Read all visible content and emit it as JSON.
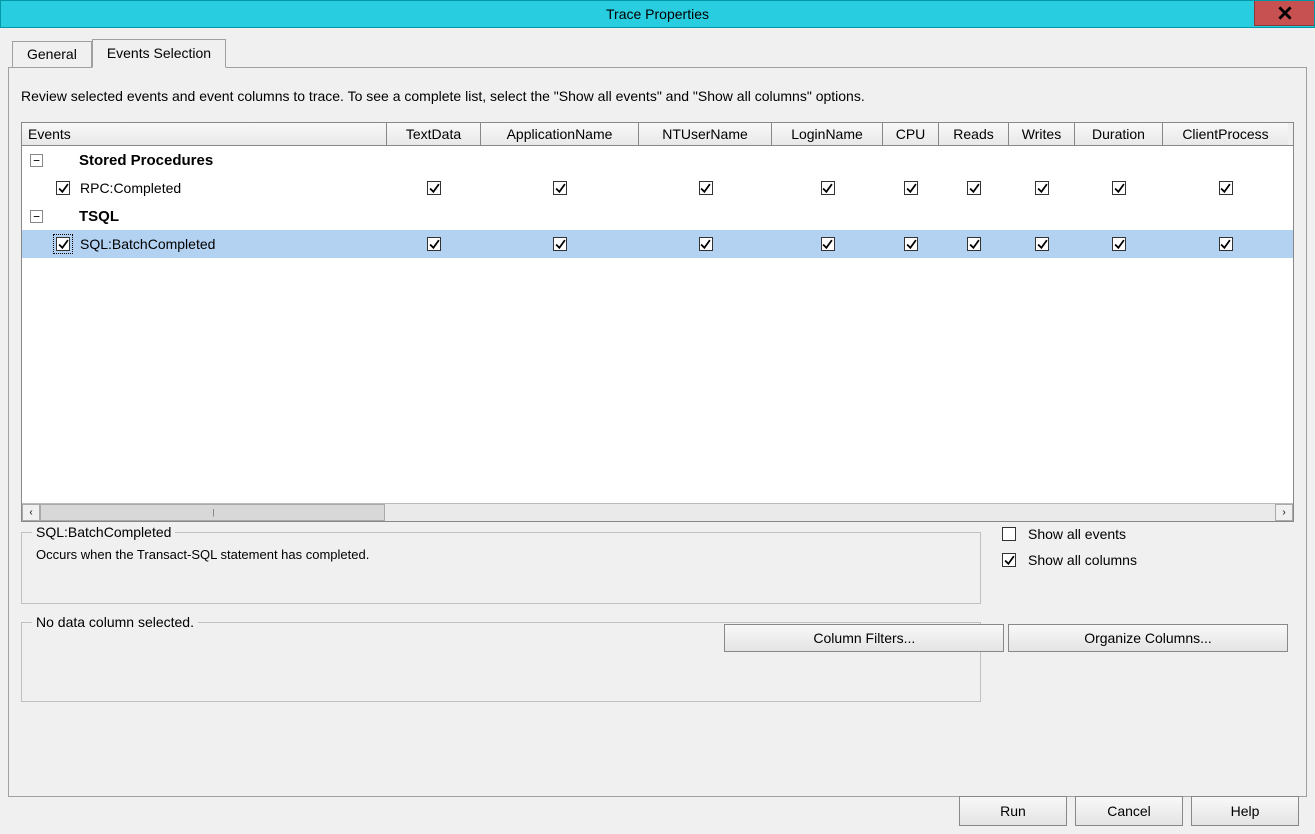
{
  "window": {
    "title": "Trace Properties"
  },
  "tabs": {
    "general": "General",
    "events": "Events Selection"
  },
  "instructions": "Review selected events and event columns to trace. To see a complete list, select the \"Show all events\" and \"Show all columns\" options.",
  "columns": {
    "events": "Events",
    "textdata": "TextData",
    "appname": "ApplicationName",
    "ntuser": "NTUserName",
    "login": "LoginName",
    "cpu": "CPU",
    "reads": "Reads",
    "writes": "Writes",
    "duration": "Duration",
    "client": "ClientProcess"
  },
  "categories": [
    {
      "name": "Stored Procedures",
      "events": [
        {
          "name": "RPC:Completed",
          "checked": true,
          "selected": false,
          "cols": {
            "textdata": true,
            "appname": true,
            "ntuser": true,
            "login": true,
            "cpu": true,
            "reads": true,
            "writes": true,
            "duration": true,
            "client": true
          }
        }
      ]
    },
    {
      "name": "TSQL",
      "events": [
        {
          "name": "SQL:BatchCompleted",
          "checked": true,
          "selected": true,
          "cols": {
            "textdata": true,
            "appname": true,
            "ntuser": true,
            "login": true,
            "cpu": true,
            "reads": true,
            "writes": true,
            "duration": true,
            "client": true
          }
        }
      ]
    }
  ],
  "description": {
    "title": "SQL:BatchCompleted",
    "text": "Occurs when the Transact-SQL statement has completed."
  },
  "group2": {
    "title": "No data column selected."
  },
  "options": {
    "show_all_events": {
      "label": "Show all events",
      "checked": false
    },
    "show_all_columns": {
      "label": "Show all columns",
      "checked": true
    }
  },
  "buttons": {
    "column_filters": "Column Filters...",
    "organize_columns": "Organize Columns...",
    "run": "Run",
    "cancel": "Cancel",
    "help": "Help"
  },
  "glyphs": {
    "minus": "−",
    "left": "‹",
    "right": "›",
    "grip": "|||"
  }
}
